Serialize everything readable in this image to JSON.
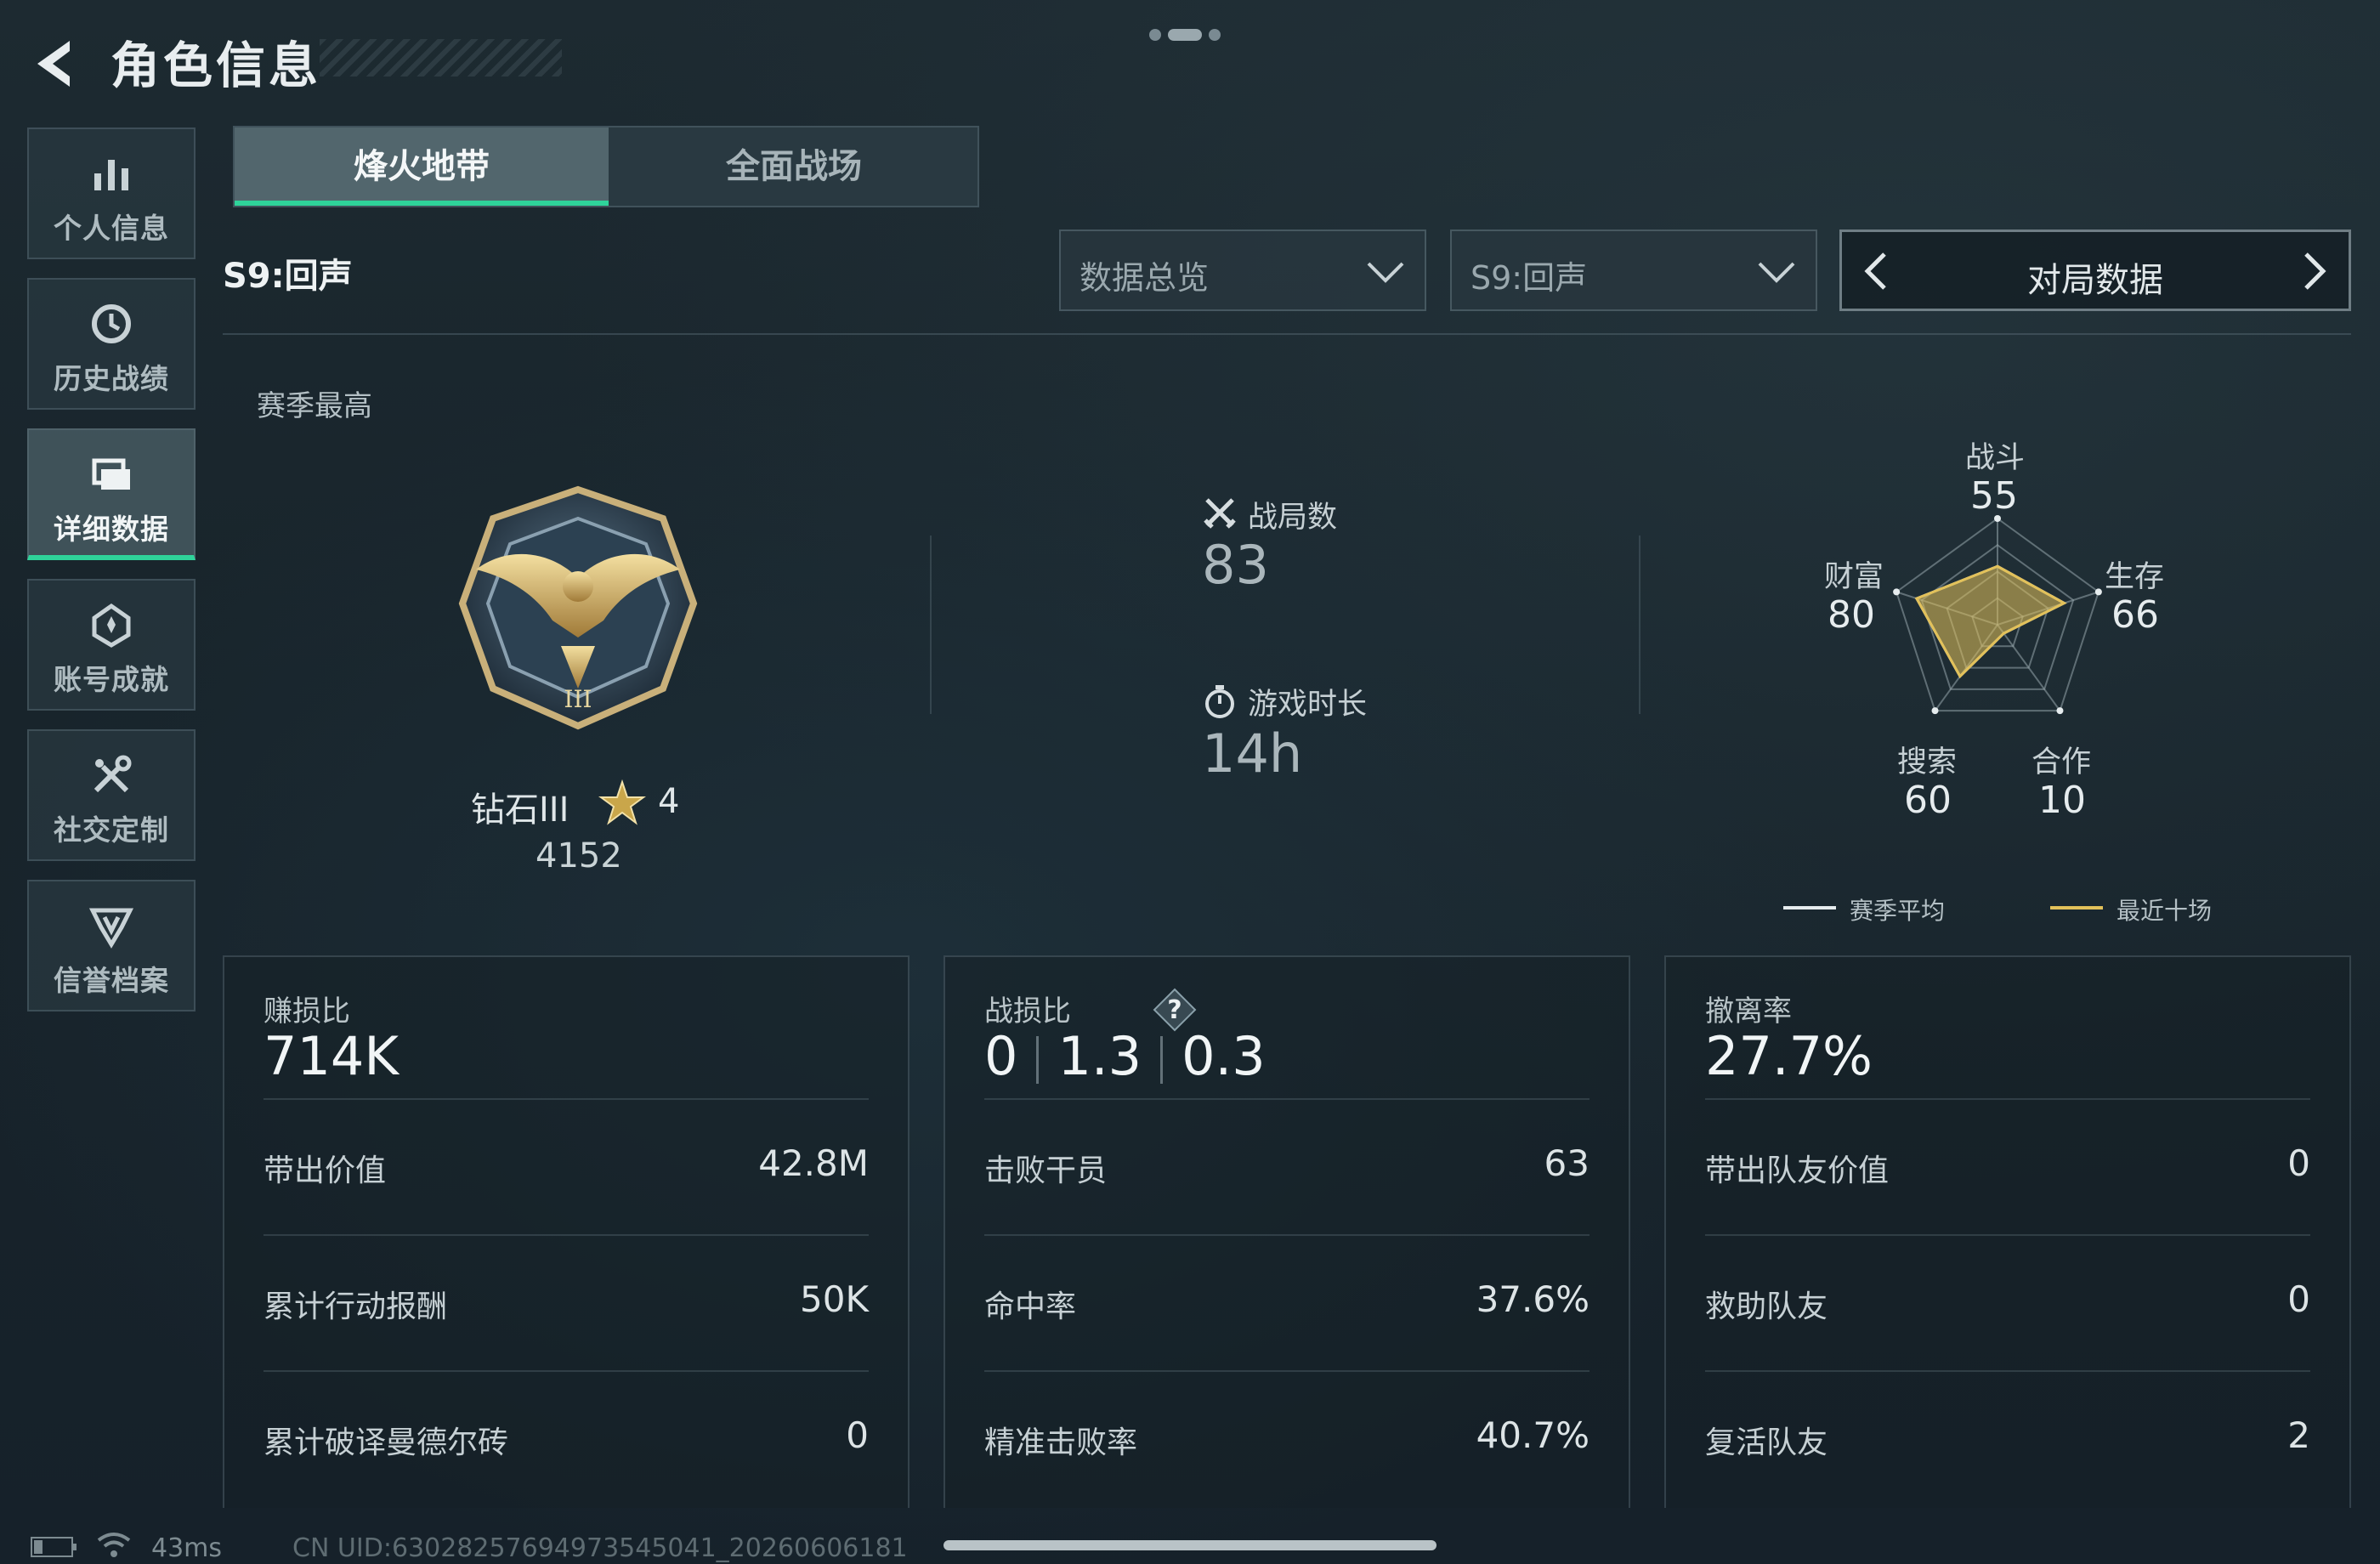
{
  "header": {
    "title": "角色信息"
  },
  "sidebar": {
    "items": [
      {
        "label": "个人信息",
        "icon": "bar-chart-icon"
      },
      {
        "label": "历史战绩",
        "icon": "history-icon"
      },
      {
        "label": "详细数据",
        "icon": "folder-icon",
        "active": true
      },
      {
        "label": "账号成就",
        "icon": "achievement-icon"
      },
      {
        "label": "社交定制",
        "icon": "tools-icon"
      },
      {
        "label": "信誉档案",
        "icon": "shield-icon"
      }
    ]
  },
  "tabs": [
    {
      "label": "烽火地带",
      "active": true
    },
    {
      "label": "全面战场",
      "active": false
    }
  ],
  "season": {
    "label": "S9:回声",
    "dropdown_view": "数据总览",
    "dropdown_season": "S9:回声",
    "switcher_label": "对局数据"
  },
  "season_best": {
    "label": "赛季最高",
    "rank_name": "钻石III",
    "stars": "4",
    "score": "4152"
  },
  "stats": {
    "matches_label": "战局数",
    "matches_value": "83",
    "playtime_label": "游戏时长",
    "playtime_value": "14h"
  },
  "radar": {
    "axes": [
      {
        "label": "战斗",
        "value": "55"
      },
      {
        "label": "生存",
        "value": "66"
      },
      {
        "label": "合作",
        "value": "10"
      },
      {
        "label": "搜索",
        "value": "60"
      },
      {
        "label": "财富",
        "value": "80"
      }
    ],
    "legend": [
      {
        "label": "赛季平均",
        "color": "#e6ecee"
      },
      {
        "label": "最近十场",
        "color": "#e2c15a"
      }
    ]
  },
  "panels": [
    {
      "header": "赚损比",
      "value": "714K",
      "rows": [
        {
          "label": "带出价值",
          "value": "42.8M"
        },
        {
          "label": "累计行动报酬",
          "value": "50K"
        },
        {
          "label": "累计破译曼德尔砖",
          "value": "0"
        }
      ]
    },
    {
      "header": "战损比",
      "values": [
        "0",
        "1.3",
        "0.3"
      ],
      "rows": [
        {
          "label": "击败干员",
          "value": "63"
        },
        {
          "label": "命中率",
          "value": "37.6%"
        },
        {
          "label": "精准击败率",
          "value": "40.7%"
        }
      ]
    },
    {
      "header": "撤离率",
      "value": "27.7%",
      "rows": [
        {
          "label": "带出队友价值",
          "value": "0"
        },
        {
          "label": "救助队友",
          "value": "0"
        },
        {
          "label": "复活队友",
          "value": "2"
        }
      ]
    }
  ],
  "footer": {
    "ping": "43ms",
    "uid": "CN UID:63028257694973545041_20260606181"
  },
  "colors": {
    "accent": "#2fd39a",
    "radar_recent": "#e2c15a"
  }
}
